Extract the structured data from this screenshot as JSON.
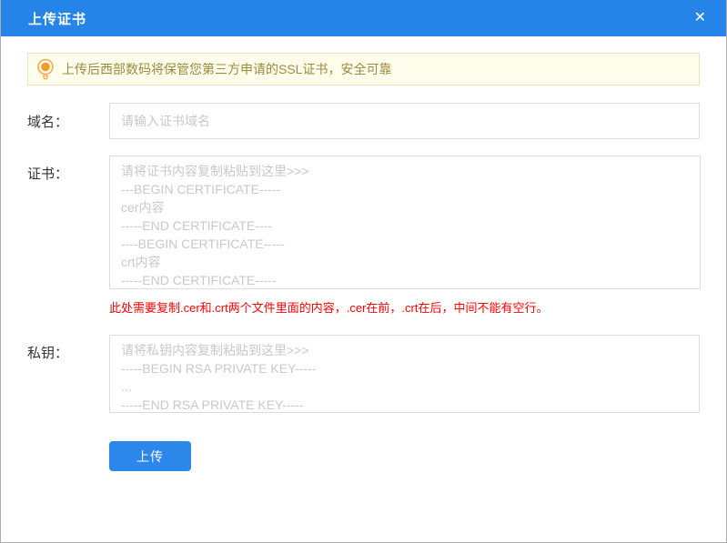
{
  "dialog": {
    "title": "上传证书",
    "close_glyph": "✕"
  },
  "notice": {
    "icon": "lightbulb-icon",
    "text": "上传后西部数码将保管您第三方申请的SSL证书，安全可靠"
  },
  "form": {
    "domain": {
      "label": "域名：",
      "value": "",
      "placeholder": "请输入证书域名"
    },
    "certificate": {
      "label": "证书：",
      "value": "",
      "placeholder": "请将证书内容复制粘贴到这里>>>\n---BEGIN CERTIFICATE-----\ncer内容\n-----END CERTIFICATE----\n----BEGIN CERTIFICATE-----\ncrt内容\n-----END CERTIFICATE-----",
      "note": "此处需要复制.cer和.crt两个文件里面的内容，.cer在前，.crt在后，中间不能有空行。"
    },
    "private_key": {
      "label": "私钥：",
      "value": "",
      "placeholder": "请将私钥内容复制粘贴到这里>>>\n-----BEGIN RSA PRIVATE KEY-----\n...\n-----END RSA PRIVATE KEY-----"
    },
    "submit_label": "上传"
  },
  "colors": {
    "header_bg": "#2584e8",
    "accent": "#2b87ea",
    "notice_bg": "#fffdec",
    "notice_border": "#ece3bd",
    "notice_text": "#9c8a3e",
    "error_text": "#ff0000"
  }
}
